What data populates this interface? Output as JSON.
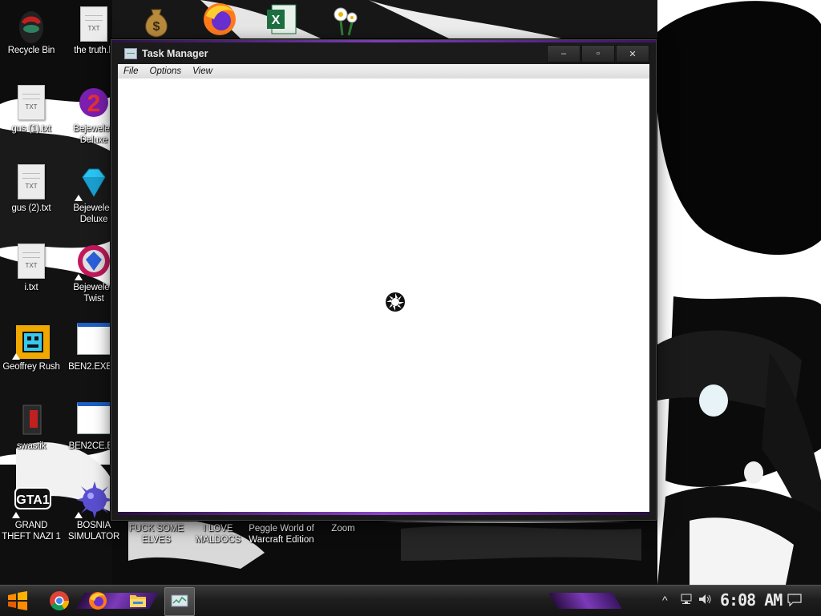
{
  "desktop_icons": [
    {
      "id": "recycle-bin",
      "label": "Recycle Bin",
      "icon": "recycle-bin-icon"
    },
    {
      "id": "the-truth",
      "label": "the truth.b",
      "icon": "text-file-icon"
    },
    {
      "id": "money",
      "label": "",
      "icon": "money-bag-icon"
    },
    {
      "id": "firefox",
      "label": "",
      "icon": "firefox-icon"
    },
    {
      "id": "excel",
      "label": "",
      "icon": "excel-icon"
    },
    {
      "id": "flowers",
      "label": "",
      "icon": "flowers-icon"
    },
    {
      "id": "gus1",
      "label": "gus (1).txt",
      "icon": "text-file-icon"
    },
    {
      "id": "bejeweled2",
      "label": "Bejeweled Deluxe",
      "icon": "bejeweled-2-icon"
    },
    {
      "id": "gus2",
      "label": "gus (2).txt",
      "icon": "text-file-icon"
    },
    {
      "id": "bejeweled-deluxe",
      "label": "Bejeweled Deluxe",
      "icon": "bejeweled-gem-icon"
    },
    {
      "id": "i-txt",
      "label": "i.txt",
      "icon": "text-file-icon"
    },
    {
      "id": "bejeweled-twist",
      "label": "Bejeweled Twist",
      "icon": "bejeweled-twist-icon"
    },
    {
      "id": "geoffrey-rush",
      "label": "Geoffrey Rush",
      "icon": "geometry-dash-icon"
    },
    {
      "id": "ben2-exe",
      "label": "BEN2.EXE.e",
      "icon": "window-file-icon"
    },
    {
      "id": "swastik",
      "label": "swastik",
      "icon": "pc-tower-icon"
    },
    {
      "id": "ben2ce-exe",
      "label": "BEN2CE.EX",
      "icon": "window-file-icon"
    },
    {
      "id": "gta",
      "label": "GRAND THEFT NAZI 1",
      "icon": "gta-icon"
    },
    {
      "id": "bosnia",
      "label": "BOSNIA SIMULATOR",
      "icon": "spiked-ball-icon"
    },
    {
      "id": "elves",
      "label": "FUCK SOME ELVES",
      "icon": ""
    },
    {
      "id": "maldocs",
      "label": "I LOVE MALDOCS",
      "icon": ""
    },
    {
      "id": "peggle",
      "label": "Peggle World of Warcraft Edition",
      "icon": ""
    },
    {
      "id": "zoom",
      "label": "Zoom",
      "icon": ""
    }
  ],
  "window": {
    "title": "Task Manager",
    "controls": {
      "minimize": "–",
      "maximize": "▫",
      "close": "✕"
    },
    "menu": [
      "File",
      "Options",
      "View"
    ],
    "state": "loading"
  },
  "taskbar": {
    "clock": "6:08 AM",
    "pinned": [
      "start-icon",
      "chrome-icon",
      "firefox-icon",
      "file-explorer-icon",
      "task-manager-icon"
    ],
    "tray_arrow": "^",
    "notification_icon": "notification-icon"
  },
  "colors": {
    "accent_purple": "#7a3fb8",
    "window_frame": "#1b1b1b",
    "taskbar": "#1e1e1e"
  }
}
